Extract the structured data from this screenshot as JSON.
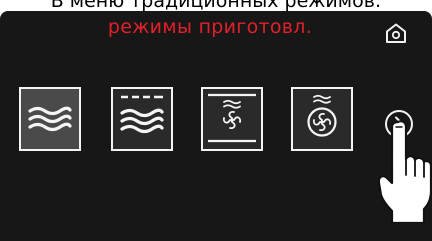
{
  "caption": {
    "text": "В меню традиционных режимов:"
  },
  "screen": {
    "title": "режимы приготовл.",
    "title_color": "#e2202b",
    "background_color": "#171717",
    "home_icon": "home-icon",
    "next_icon": "chevron-right-circle-icon"
  },
  "modes": [
    {
      "icon": "top-bottom-heat-icon",
      "selected": true
    },
    {
      "icon": "top-bottom-heat-with-grill-icon",
      "selected": false
    },
    {
      "icon": "convection-fan-top-bottom-heat-icon",
      "selected": false
    },
    {
      "icon": "convection-fan-ring-heat-icon",
      "selected": false
    }
  ],
  "pointer": {
    "icon": "pointing-hand-icon"
  }
}
